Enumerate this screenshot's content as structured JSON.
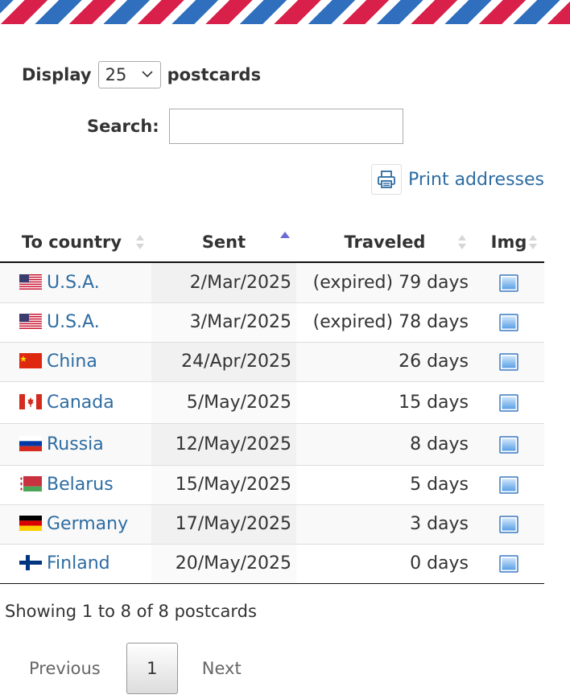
{
  "length": {
    "prefix": "Display",
    "value": "25",
    "suffix": "postcards"
  },
  "search": {
    "label": "Search:",
    "value": ""
  },
  "print": {
    "label": "Print addresses"
  },
  "table": {
    "headers": [
      "To country",
      "Sent",
      "Traveled",
      "Img"
    ],
    "rows": [
      {
        "flag": "us",
        "country": "U.S.A.",
        "sent": "2/Mar/2025",
        "traveled": "(expired) 79 days"
      },
      {
        "flag": "us",
        "country": "U.S.A.",
        "sent": "3/Mar/2025",
        "traveled": "(expired) 78 days"
      },
      {
        "flag": "cn",
        "country": "China",
        "sent": "24/Apr/2025",
        "traveled": "26 days"
      },
      {
        "flag": "ca",
        "country": "Canada",
        "sent": "5/May/2025",
        "traveled": "15 days"
      },
      {
        "flag": "ru",
        "country": "Russia",
        "sent": "12/May/2025",
        "traveled": "8 days"
      },
      {
        "flag": "by",
        "country": "Belarus",
        "sent": "15/May/2025",
        "traveled": "5 days"
      },
      {
        "flag": "de",
        "country": "Germany",
        "sent": "17/May/2025",
        "traveled": "3 days"
      },
      {
        "flag": "fi",
        "country": "Finland",
        "sent": "20/May/2025",
        "traveled": "0 days"
      }
    ]
  },
  "info": "Showing 1 to 8 of 8 postcards",
  "pagination": {
    "previous": "Previous",
    "current": "1",
    "next": "Next"
  },
  "colors": {
    "link": "#2d6ca2",
    "airmail_red": "#d9204a",
    "airmail_blue": "#2f6fbd",
    "sort_active": "#6b6bd6"
  }
}
